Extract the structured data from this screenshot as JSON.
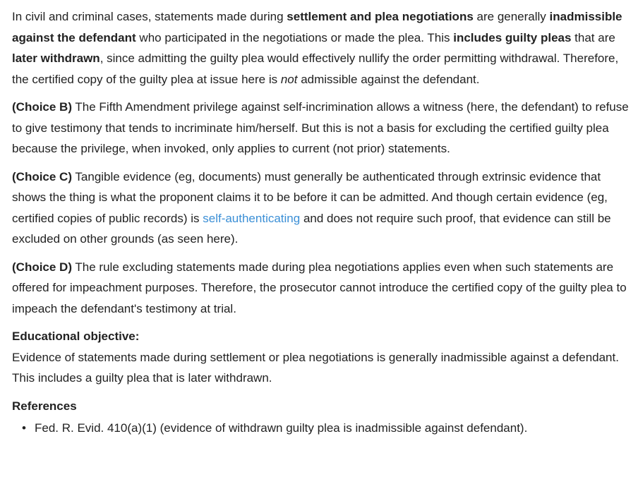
{
  "para1": {
    "t1": "In civil and criminal cases, statements made during ",
    "b1": "settlement and plea negotiations",
    "t2": " are generally ",
    "b2": "inadmissible against the defendant",
    "t3": " who participated in the negotiations or made the plea.  This ",
    "b3": "includes guilty pleas",
    "t4": " that are ",
    "b4": "later withdrawn",
    "t5": ", since admitting the guilty plea would effectively nullify the order permitting withdrawal.  Therefore, the certified copy of the guilty plea at issue here is ",
    "i1": "not",
    "t6": " admissible against the defendant."
  },
  "choice_b": {
    "label": "(Choice B)",
    "text": "  The Fifth Amendment privilege against self-incrimination allows a witness (here, the defendant) to refuse to give testimony that tends to incriminate him/herself.  But this is not a basis for excluding the certified guilty plea because the privilege, when invoked, only applies to current (not prior) statements."
  },
  "choice_c": {
    "label": "(Choice C)",
    "t1": "  Tangible evidence (eg, documents) must generally be authenticated through extrinsic evidence that shows the thing is what the proponent claims it to be before it can be admitted.  And though certain evidence (eg, certified copies of public records) is ",
    "link": "self-authenticating",
    "t2": " and does not require such proof, that evidence can still be excluded on other grounds (as seen here)."
  },
  "choice_d": {
    "label": "(Choice D)",
    "text": "  The rule excluding statements made during plea negotiations applies even when such statements are offered for impeachment purposes.  Therefore, the prosecutor cannot introduce the certified copy of the guilty plea to impeach the defendant's testimony at trial."
  },
  "objective": {
    "heading": "Educational objective:",
    "text": "Evidence of statements made during settlement or plea negotiations is generally inadmissible against a defendant.  This includes a guilty plea that is later withdrawn."
  },
  "references": {
    "heading": "References",
    "bullet": "•",
    "items": [
      "Fed. R. Evid. 410(a)(1) (evidence of withdrawn guilty plea is inadmissible against defendant)."
    ]
  },
  "colors": {
    "text": "#222222",
    "link": "#3b8fd6",
    "background": "#ffffff"
  }
}
